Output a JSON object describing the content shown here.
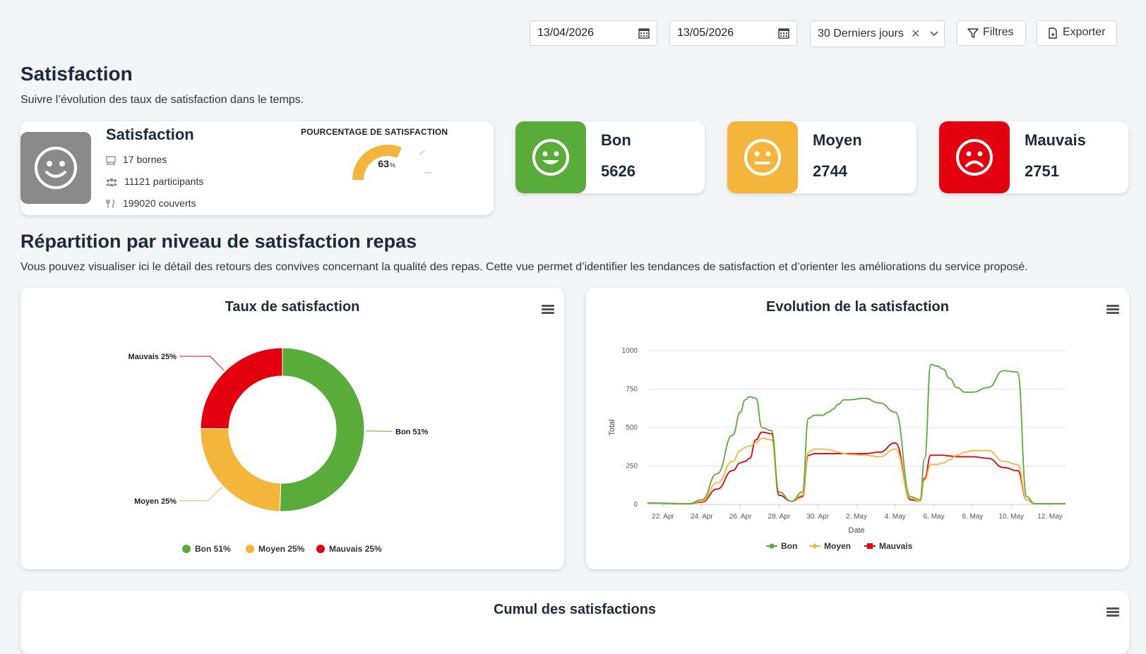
{
  "filters": {
    "start_date": "13/04/2026",
    "end_date": "13/05/2026",
    "period": "30 Derniers jours",
    "clear_symbol": "✕",
    "filters_label": "Filtres",
    "export_label": "Exporter"
  },
  "page": {
    "title": "Satisfaction",
    "subtitle": "Suivre l’évolution des taux de satisfaction dans le temps."
  },
  "summary": {
    "name": "Satisfaction",
    "bornes": "17 bornes",
    "participants": "11121 participants",
    "couverts": "199020 couverts",
    "percentage_label": "POURCENTAGE DE SATISFACTION",
    "percentage_value": "63",
    "percentage_unit": "%",
    "percentage": 63
  },
  "kpis": [
    {
      "label": "Bon",
      "value": "5626",
      "color": "#5aac3a",
      "icon": "happy-face-icon"
    },
    {
      "label": "Moyen",
      "value": "2744",
      "color": "#f3b53c",
      "icon": "neutral-face-icon"
    },
    {
      "label": "Mauvais",
      "value": "2751",
      "color": "#e3000f",
      "icon": "sad-face-icon"
    }
  ],
  "section": {
    "title": "Répartition par niveau de satisfaction repas",
    "description": "Vous pouvez visualiser ici le détail des retours des convives concernant la qualité des repas. Cette vue permet d’identifier les tendances de satisfaction et d’orienter les améliorations du service proposé."
  },
  "cumul": {
    "title": "Cumul des satisfactions"
  },
  "chart_data": [
    {
      "type": "pie",
      "title": "Taux de satisfaction",
      "slices": [
        {
          "name": "Bon",
          "value": 51,
          "label": "Bon 51%",
          "color": "#5aac3a"
        },
        {
          "name": "Moyen",
          "value": 25,
          "label": "Moyen 25%",
          "color": "#f3b53c"
        },
        {
          "name": "Mauvais",
          "value": 25,
          "label": "Mauvais 25%",
          "color": "#e3000f"
        }
      ],
      "legend": [
        "Bon 51%",
        "Moyen 25%",
        "Mauvais 25%"
      ],
      "legend_position": "bottom"
    },
    {
      "type": "line",
      "title": "Evolution de la satisfaction",
      "xlabel": "Date",
      "ylabel": "Total",
      "ylim": [
        0,
        1000
      ],
      "yticks": [
        "0",
        "250",
        "500",
        "750",
        "1000"
      ],
      "xticks": [
        "22. Apr",
        "24. Apr",
        "26. Apr",
        "28. Apr",
        "30. Apr",
        "2. May",
        "4. May",
        "6. May",
        "8. May",
        "10. May",
        "12. May"
      ],
      "x_start": "2026-04-22",
      "x": [
        0,
        1,
        2,
        2.7,
        3.5,
        4.5,
        5.5,
        6,
        6.3,
        6.6,
        7,
        7.4,
        8,
        8.5,
        9.3,
        10,
        10.4,
        10.8,
        11.3,
        11.7,
        12,
        12.3,
        12.7,
        13,
        14,
        15,
        16,
        17,
        17.6,
        17.9,
        18.3,
        18.7,
        19.1,
        19.5,
        20,
        20.5,
        21,
        22,
        23,
        23.9,
        24.5,
        25,
        25.5,
        26,
        26.4,
        26.8,
        27
      ],
      "series": [
        {
          "name": "Bon",
          "color": "#5aac3a",
          "values": [
            10,
            8,
            5,
            5,
            30,
            200,
            450,
            600,
            680,
            700,
            690,
            500,
            480,
            80,
            20,
            80,
            560,
            580,
            580,
            600,
            620,
            650,
            680,
            680,
            690,
            660,
            600,
            50,
            30,
            300,
            910,
            900,
            880,
            820,
            760,
            730,
            730,
            760,
            870,
            860,
            50,
            5,
            5,
            5,
            5,
            5,
            5
          ]
        },
        {
          "name": "Moyen",
          "color": "#f3b53c",
          "values": [
            10,
            8,
            5,
            5,
            20,
            140,
            280,
            350,
            370,
            380,
            400,
            430,
            420,
            80,
            20,
            60,
            340,
            360,
            360,
            355,
            350,
            340,
            330,
            325,
            320,
            310,
            360,
            40,
            20,
            160,
            260,
            260,
            270,
            290,
            320,
            340,
            350,
            350,
            280,
            260,
            30,
            5,
            5,
            5,
            5,
            5,
            5
          ]
        },
        {
          "name": "Mauvais",
          "color": "#e3000f",
          "values": [
            10,
            8,
            5,
            5,
            15,
            100,
            220,
            270,
            280,
            300,
            420,
            470,
            460,
            60,
            20,
            50,
            320,
            330,
            330,
            330,
            330,
            330,
            330,
            330,
            330,
            340,
            400,
            30,
            20,
            170,
            320,
            320,
            320,
            315,
            310,
            310,
            310,
            300,
            240,
            220,
            30,
            5,
            5,
            5,
            5,
            5,
            5
          ]
        }
      ],
      "legend": [
        "Bon",
        "Moyen",
        "Mauvais"
      ],
      "legend_position": "bottom",
      "grid": true
    }
  ]
}
